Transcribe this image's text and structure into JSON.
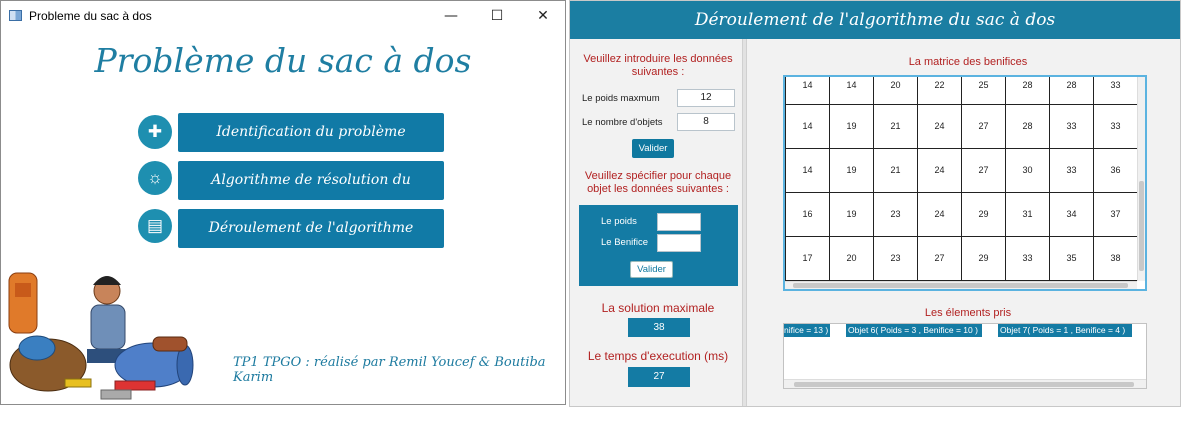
{
  "window1": {
    "title": "Probleme du sac à dos",
    "controls": {
      "minimize": "—",
      "maximize": "☐",
      "close": "✕"
    },
    "heading": "Problème du sac à dos",
    "menu": [
      {
        "label": "Identification du problème",
        "icon": "puzzle-icon",
        "glyph": "✚"
      },
      {
        "label": "Algorithme de résolution du problème",
        "icon": "lightbulb-icon",
        "glyph": "☼"
      },
      {
        "label": "Déroulement de l'algorithme",
        "icon": "book-icon",
        "glyph": "▤"
      }
    ],
    "credits": "TP1 TPGO : réalisé par Remil Youcef & Boutiba Karim"
  },
  "window2": {
    "header": "Déroulement de l'algorithme du sac à dos",
    "intro": "Veuillez introduire les données suivantes :",
    "poids_label": "Le poids maxmum",
    "poids_value": "12",
    "nombre_label": "Le nombre d'objets",
    "nombre_value": "8",
    "valider": "Valider",
    "spec": "Veuillez spécifier pour chaque objet les données suivantes :",
    "obj_poids_label": "Le poids",
    "obj_benifice_label": "Le Benifice",
    "solution_label": "La solution maximale",
    "solution_value": "38",
    "time_label": "Le temps d'execution (ms)",
    "time_value": "27",
    "matrix_title": "La matrice des benifices",
    "matrix_rows": [
      [
        "14",
        "14",
        "20",
        "22",
        "25",
        "28",
        "28",
        "33"
      ],
      [
        "14",
        "19",
        "21",
        "24",
        "27",
        "28",
        "33",
        "33"
      ],
      [
        "14",
        "19",
        "21",
        "24",
        "27",
        "30",
        "33",
        "36"
      ],
      [
        "16",
        "19",
        "23",
        "24",
        "29",
        "31",
        "34",
        "37"
      ],
      [
        "17",
        "20",
        "23",
        "27",
        "29",
        "33",
        "35",
        "38"
      ]
    ],
    "taken_title": "Les élements pris",
    "taken_items": [
      "nifice = 13 )",
      "Objet 6( Poids = 3 , Benifice = 10 )",
      "Objet 7( Poids = 1 , Benifice = 4 )"
    ],
    "colors": {
      "accent": "#147ba4",
      "heading_red": "#b22222"
    }
  }
}
